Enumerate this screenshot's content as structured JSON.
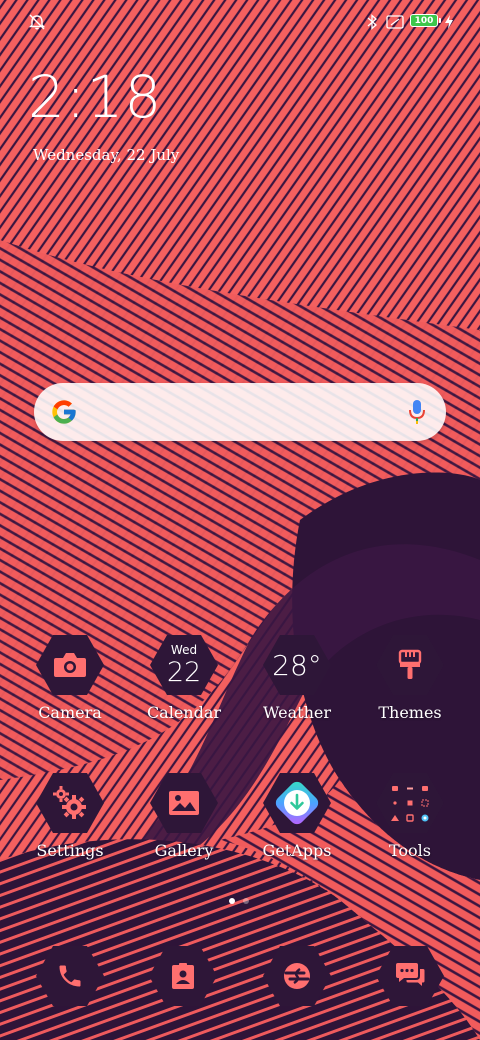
{
  "status_bar": {
    "battery_level": "100",
    "icons": [
      "alarm-off-icon",
      "bluetooth-icon",
      "no-sim-icon",
      "battery-icon",
      "charging-icon"
    ]
  },
  "lock_clock": {
    "time": "2:18",
    "date": "Wednesday, 22 July"
  },
  "search": {
    "icons": [
      "google-logo-icon",
      "microphone-icon"
    ]
  },
  "apps_row1": [
    {
      "label": "Camera",
      "icon": "camera-icon"
    },
    {
      "label": "Calendar",
      "icon": "calendar-icon",
      "day": "Wed",
      "date": "22"
    },
    {
      "label": "Weather",
      "icon": "weather-icon",
      "temp": "28°"
    },
    {
      "label": "Themes",
      "icon": "paintbrush-icon"
    }
  ],
  "apps_row2": [
    {
      "label": "Settings",
      "icon": "gears-icon"
    },
    {
      "label": "Gallery",
      "icon": "image-icon"
    },
    {
      "label": "GetApps",
      "icon": "download-icon"
    },
    {
      "label": "Tools",
      "icon": "tools-folder-icon"
    }
  ],
  "page_indicator": {
    "pages": 2,
    "current": 1
  },
  "dock": [
    {
      "icon": "phone-icon"
    },
    {
      "icon": "contacts-icon"
    },
    {
      "icon": "browser-icon"
    },
    {
      "icon": "messages-icon"
    }
  ],
  "colors": {
    "wallpaper_coral": "#f05a5e",
    "wallpaper_plum": "#2e1438",
    "icon_hex": "#2e1638",
    "icon_accent": "#ff6f6f",
    "battery_green": "#3cc64a"
  }
}
